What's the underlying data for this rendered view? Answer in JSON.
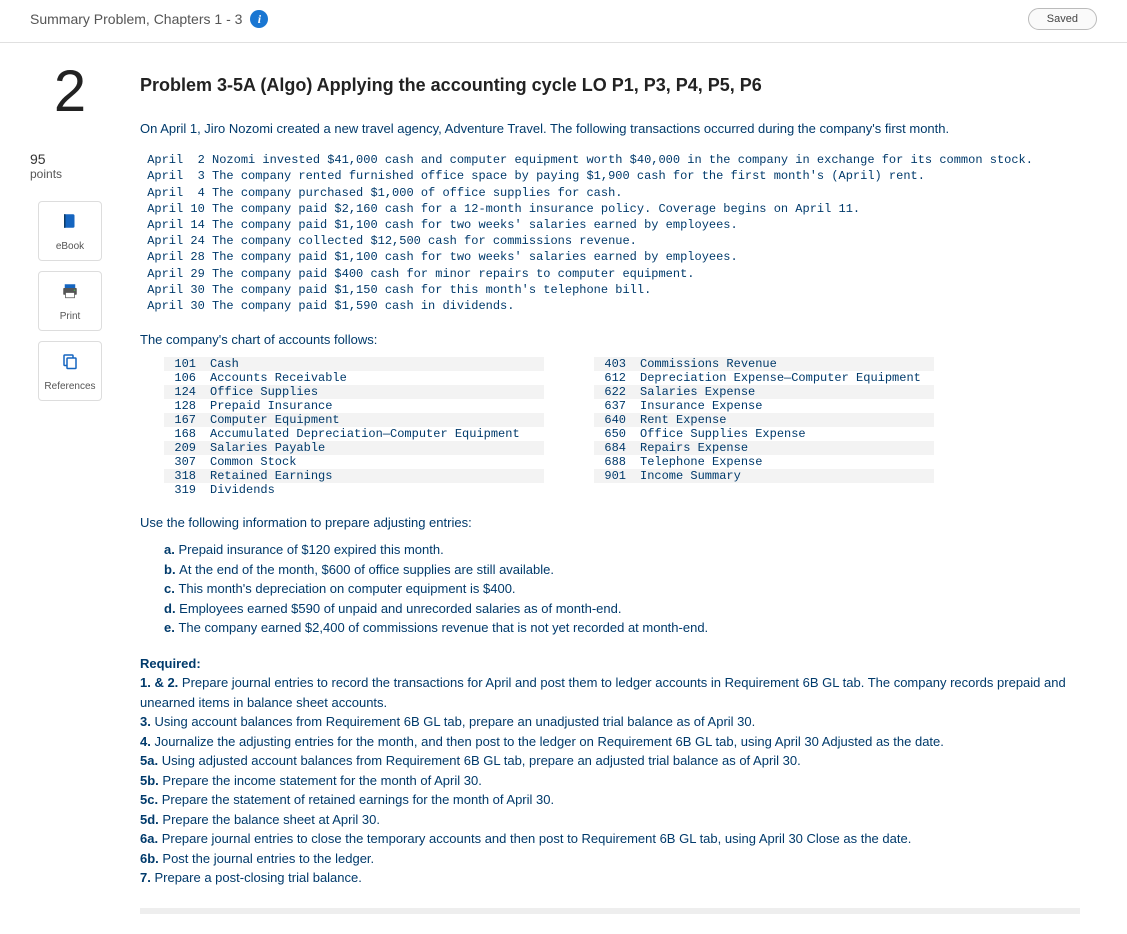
{
  "header": {
    "breadcrumb": "Summary Problem, Chapters 1 - 3",
    "saved_label": "Saved"
  },
  "left": {
    "question_number": "2",
    "points_value": "95",
    "points_label": "points",
    "tools": {
      "ebook": "eBook",
      "print": "Print",
      "references": "References"
    }
  },
  "problem": {
    "title": "Problem 3-5A (Algo) Applying the accounting cycle LO P1, P3, P4, P5, P6",
    "intro": "On April 1, Jiro Nozomi created a new travel agency, Adventure Travel. The following transactions occurred during the company's first month.",
    "transactions": [
      {
        "date": "April  2",
        "text": "Nozomi invested $41,000 cash and computer equipment worth $40,000 in the company in exchange for its common stock."
      },
      {
        "date": "April  3",
        "text": "The company rented furnished office space by paying $1,900 cash for the first month's (April) rent."
      },
      {
        "date": "April  4",
        "text": "The company purchased $1,000 of office supplies for cash."
      },
      {
        "date": "April 10",
        "text": "The company paid $2,160 cash for a 12-month insurance policy. Coverage begins on April 11."
      },
      {
        "date": "April 14",
        "text": "The company paid $1,100 cash for two weeks' salaries earned by employees."
      },
      {
        "date": "April 24",
        "text": "The company collected $12,500 cash for commissions revenue."
      },
      {
        "date": "April 28",
        "text": "The company paid $1,100 cash for two weeks' salaries earned by employees."
      },
      {
        "date": "April 29",
        "text": "The company paid $400 cash for minor repairs to computer equipment."
      },
      {
        "date": "April 30",
        "text": "The company paid $1,150 cash for this month's telephone bill."
      },
      {
        "date": "April 30",
        "text": "The company paid $1,590 cash in dividends."
      }
    ],
    "coa_label": "The company's chart of accounts follows:",
    "coa_left": [
      {
        "num": "101",
        "name": "Cash"
      },
      {
        "num": "106",
        "name": "Accounts Receivable"
      },
      {
        "num": "124",
        "name": "Office Supplies"
      },
      {
        "num": "128",
        "name": "Prepaid Insurance"
      },
      {
        "num": "167",
        "name": "Computer Equipment"
      },
      {
        "num": "168",
        "name": "Accumulated Depreciation—Computer Equipment"
      },
      {
        "num": "209",
        "name": "Salaries Payable"
      },
      {
        "num": "307",
        "name": "Common Stock"
      },
      {
        "num": "318",
        "name": "Retained Earnings"
      },
      {
        "num": "319",
        "name": "Dividends"
      }
    ],
    "coa_right": [
      {
        "num": "403",
        "name": "Commissions Revenue"
      },
      {
        "num": "612",
        "name": "Depreciation Expense—Computer Equipment"
      },
      {
        "num": "622",
        "name": "Salaries Expense"
      },
      {
        "num": "637",
        "name": "Insurance Expense"
      },
      {
        "num": "640",
        "name": "Rent Expense"
      },
      {
        "num": "650",
        "name": "Office Supplies Expense"
      },
      {
        "num": "684",
        "name": "Repairs Expense"
      },
      {
        "num": "688",
        "name": "Telephone Expense"
      },
      {
        "num": "901",
        "name": "Income Summary"
      }
    ],
    "adjusting_label": "Use the following information to prepare adjusting entries:",
    "adjusting": [
      {
        "lbl": "a.",
        "text": "Prepaid insurance of $120 expired this month."
      },
      {
        "lbl": "b.",
        "text": "At the end of the month, $600 of office supplies are still available."
      },
      {
        "lbl": "c.",
        "text": "This month's depreciation on computer equipment is $400."
      },
      {
        "lbl": "d.",
        "text": "Employees earned $590 of unpaid and unrecorded salaries as of month-end."
      },
      {
        "lbl": "e.",
        "text": "The company earned $2,400 of commissions revenue that is not yet recorded at month-end."
      }
    ],
    "required_label": "Required:",
    "required": [
      {
        "lbl": "1. & 2.",
        "text": "Prepare journal entries to record the transactions for April and post them to ledger accounts in Requirement 6B GL tab. The company records prepaid and unearned items in balance sheet accounts."
      },
      {
        "lbl": "3.",
        "text": "Using account balances from Requirement 6B GL tab, prepare an unadjusted trial balance as of April 30."
      },
      {
        "lbl": "4.",
        "text": "Journalize the adjusting entries for the month, and then post to the ledger on Requirement 6B GL tab, using April 30 Adjusted as the date."
      },
      {
        "lbl": "5a.",
        "text": "Using adjusted account balances from Requirement 6B GL tab, prepare an adjusted trial balance as of April 30."
      },
      {
        "lbl": "5b.",
        "text": "Prepare the income statement for the month of April 30."
      },
      {
        "lbl": "5c.",
        "text": "Prepare the statement of retained earnings for the month of April 30."
      },
      {
        "lbl": "5d.",
        "text": "Prepare the balance sheet at April 30."
      },
      {
        "lbl": "6a.",
        "text": "Prepare journal entries to close the temporary accounts and then post to Requirement 6B GL tab, using April 30 Close as the date."
      },
      {
        "lbl": "6b.",
        "text": "Post the journal entries to the ledger."
      },
      {
        "lbl": "7.",
        "text": "Prepare a post-closing trial balance."
      }
    ]
  }
}
